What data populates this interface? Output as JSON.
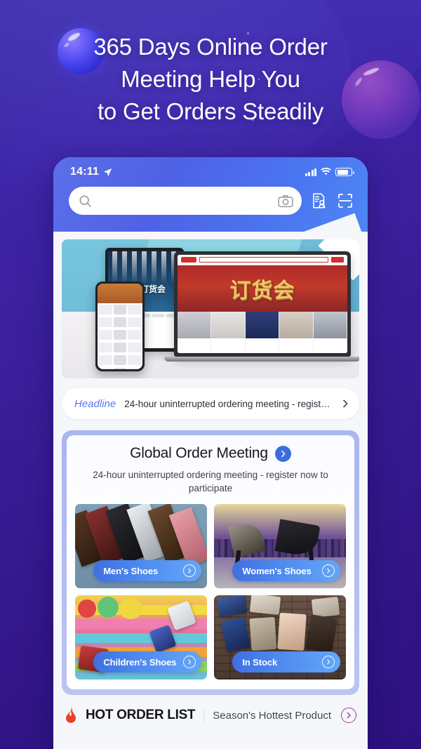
{
  "headline": {
    "line1": "365 Days Online Order",
    "line2": "Meeting Help You",
    "line3": "to Get Orders Steadily"
  },
  "colors": {
    "page_bg": "#35189a",
    "accent_blue": "#3d6ddc",
    "pill_gradient_start": "#3f6fe0",
    "pill_gradient_end": "#63a6f7",
    "headline_tag": "#5b78e8",
    "hot_chevron": "#9b3f9b",
    "flame": "#e8402a"
  },
  "phone": {
    "statusbar": {
      "time": "14:11",
      "location_icon": "location-arrow-icon",
      "signal_icon": "signal-bars-icon",
      "wifi_icon": "wifi-icon",
      "battery_icon": "battery-icon"
    },
    "search": {
      "placeholder": "",
      "value": "",
      "search_icon": "search-icon",
      "camera_icon": "camera-icon"
    },
    "header_actions": [
      {
        "icon": "contact-card-icon"
      },
      {
        "icon": "scan-code-icon"
      }
    ],
    "hero_banner": {
      "alt": "订货会 ordering meeting promotion on laptop, tablet and phone",
      "laptop_headline": "订货会",
      "tablet_headline": "女鞋订货会"
    },
    "headline_strip": {
      "tag": "Headline",
      "text": "24-hour uninterrupted ordering meeting - register...",
      "chevron_icon": "chevron-right-icon"
    },
    "global_order_meeting": {
      "title": "Global Order Meeting",
      "arrow_icon": "chevron-right-circle-icon",
      "subtitle": "24-hour uninterrupted ordering meeting - register now to participate",
      "cards": [
        {
          "label": "Men's Shoes",
          "chevron_icon": "chevron-right-circle-icon"
        },
        {
          "label": "Women's Shoes",
          "chevron_icon": "chevron-right-circle-icon"
        },
        {
          "label": "Children's Shoes",
          "chevron_icon": "chevron-right-circle-icon"
        },
        {
          "label": "In Stock",
          "chevron_icon": "chevron-right-circle-icon"
        }
      ]
    },
    "hot_order_list": {
      "flame_icon": "flame-icon",
      "title": "HOT ORDER LIST",
      "subtitle": "Season's Hottest Product",
      "chevron_icon": "chevron-right-circle-icon"
    }
  }
}
